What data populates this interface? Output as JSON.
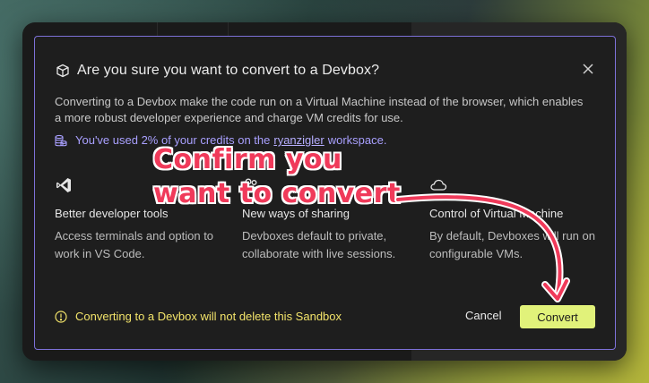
{
  "dialog": {
    "title": "Are you sure you want to convert to a Devbox?",
    "description": "Converting to a Devbox make the code run on a Virtual Machine instead of the browser, which enables a more robust developer experience and charge VM credits for use.",
    "credits_prefix": "You've used 2% of your credits on the",
    "credits_workspace": "ryanzigler",
    "credits_suffix": "workspace.",
    "features": [
      {
        "icon": "vscode-icon",
        "heading": "Better developer tools",
        "body": "Access terminals and option to work in VS Code."
      },
      {
        "icon": "users-icon",
        "heading": "New ways of sharing",
        "body": "Devboxes default to private, collaborate with live sessions."
      },
      {
        "icon": "cloud-icon",
        "heading": "Control of Virtual Machine",
        "body": "By default, Devboxes will run on configurable VMs."
      }
    ],
    "notice": "Converting to a Devbox will not delete this Sandbox",
    "cancel_label": "Cancel",
    "convert_label": "Convert"
  },
  "annotation": {
    "line1": "Confirm you",
    "line2": "want to convert"
  },
  "colors": {
    "accent": "#7d71d8",
    "convert_button": "#e1f27a",
    "notice": "#f2e36a",
    "annotation": "#f03a5a"
  }
}
